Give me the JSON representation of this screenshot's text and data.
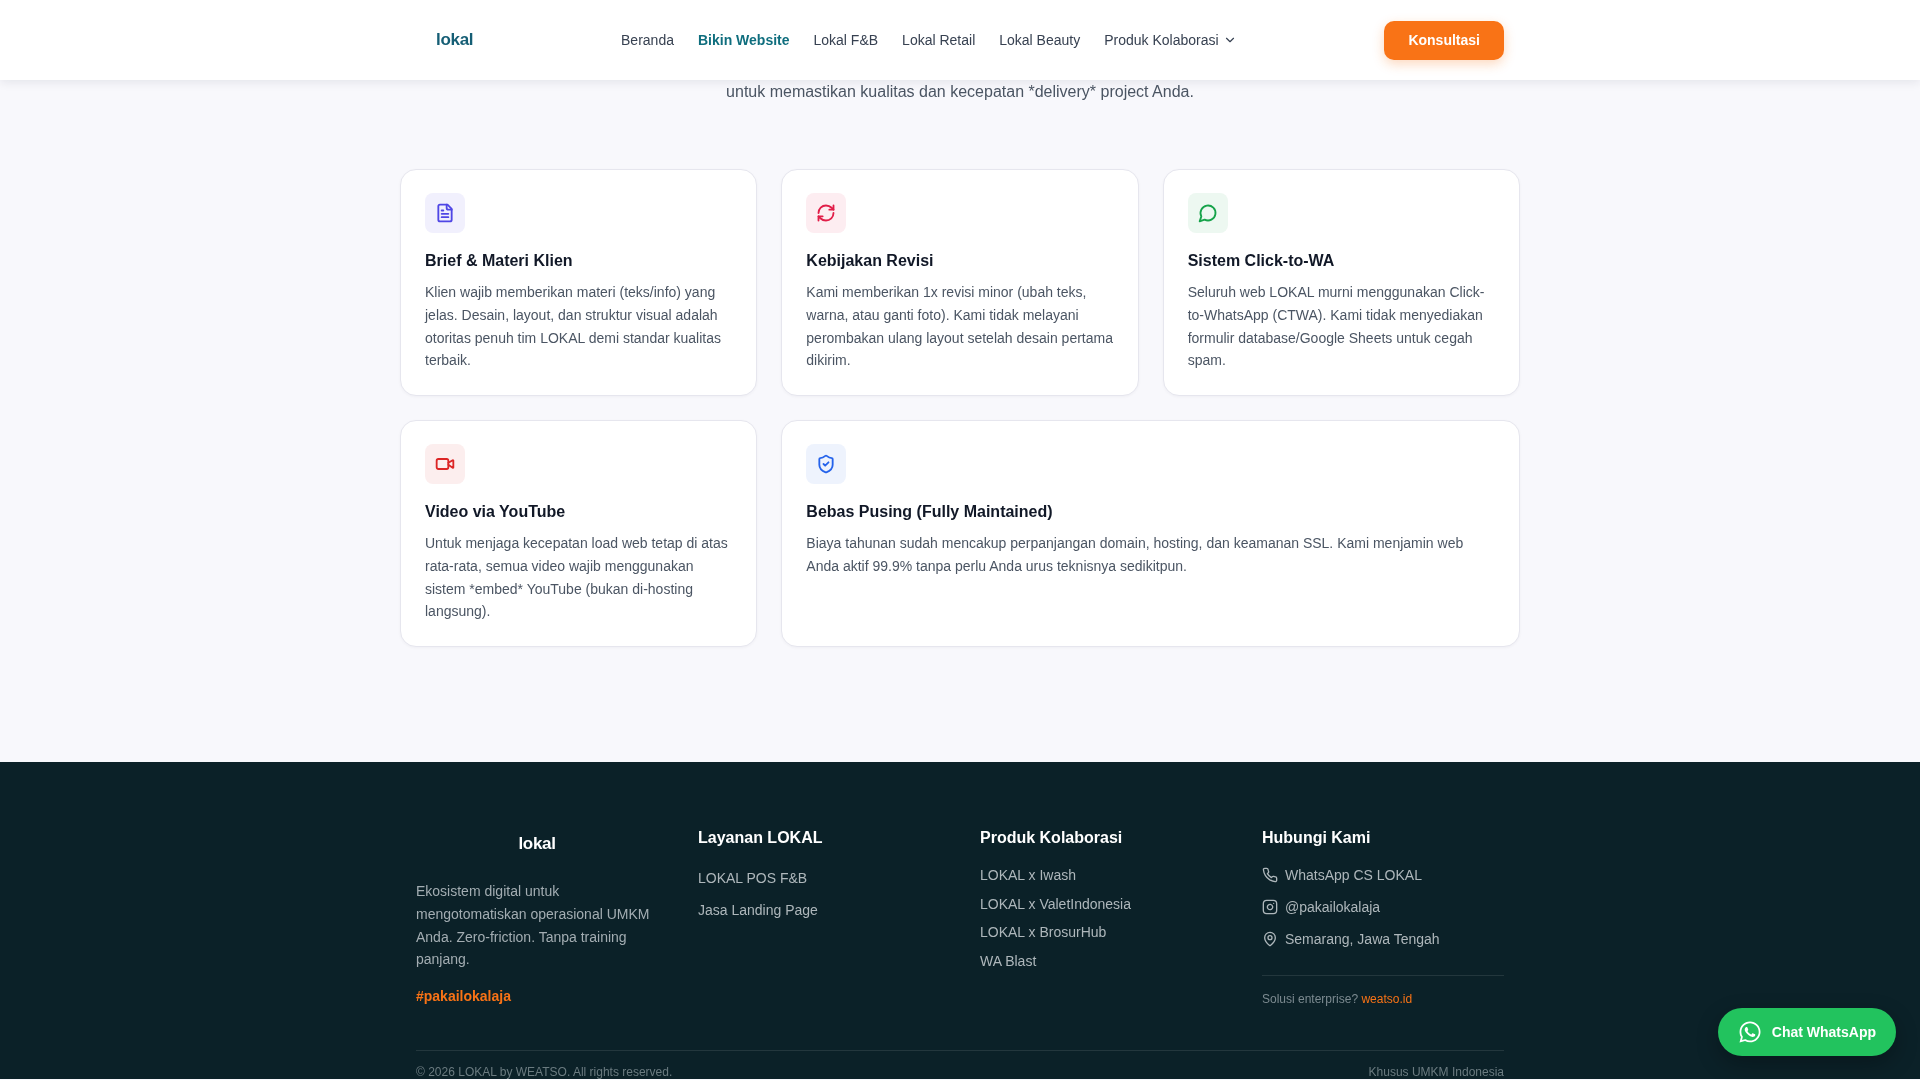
{
  "header": {
    "logo": "lokal",
    "nav": [
      {
        "label": "Beranda",
        "selected": false,
        "dropdown": false
      },
      {
        "label": "Bikin Website",
        "selected": true,
        "dropdown": false
      },
      {
        "label": "Lokal F&B",
        "selected": false,
        "dropdown": false
      },
      {
        "label": "Lokal Retail",
        "selected": false,
        "dropdown": false
      },
      {
        "label": "Lokal Beauty",
        "selected": false,
        "dropdown": false
      },
      {
        "label": "Produk Kolaborasi",
        "selected": false,
        "dropdown": true
      }
    ],
    "cta": "Konsultasi"
  },
  "intro": "untuk memastikan kualitas dan kecepatan *delivery* project Anda.",
  "cards": [
    {
      "title": "Brief & Materi Klien",
      "text": "Klien wajib memberikan materi (teks/info) yang jelas. Desain, layout, dan struktur visual adalah otoritas penuh tim LOKAL demi standar kualitas terbaik.",
      "color": "#4f46e5"
    },
    {
      "title": "Kebijakan Revisi",
      "text": "Kami memberikan 1x revisi minor (ubah teks, warna, atau ganti foto). Kami tidak melayani perombakan ulang layout setelah desain pertama dikirim.",
      "color": "#e11d48"
    },
    {
      "title": "Sistem Click-to-WA",
      "text": "Seluruh web LOKAL murni menggunakan Click-to-WhatsApp (CTWA). Kami tidak menyediakan formulir database/Google Sheets untuk cegah spam.",
      "color": "#16a34a"
    },
    {
      "title": "Video via YouTube",
      "text": "Untuk menjaga kecepatan load web tetap di atas rata-rata, semua video wajib menggunakan sistem *embed* YouTube (bukan di-hosting langsung).",
      "color": "#dc2626"
    },
    {
      "title": "Bebas Pusing (Fully Maintained)",
      "text": "Biaya tahunan sudah mencakup perpanjangan domain, hosting, dan keamanan SSL. Kami menjamin web Anda aktif 99.9% tanpa perlu Anda urus teknisnya sedikitpun.",
      "color": "#2563eb"
    }
  ],
  "footer": {
    "logo": "lokal",
    "about": "Ekosistem digital untuk mengotomatiskan operasional UMKM Anda. Zero-friction. Tanpa training panjang.",
    "hashtag": "#pakailokalaja",
    "link_columns": [
      {
        "title": "Layanan LOKAL",
        "links": [
          "LOKAL POS F&B",
          "Jasa Landing Page"
        ]
      },
      {
        "title": "Produk Kolaborasi",
        "links": [
          "LOKAL x Iwash",
          "LOKAL x ValetIndonesia",
          "LOKAL x BrosurHub",
          "WA Blast"
        ]
      }
    ],
    "contact": {
      "title": "Hubungi Kami",
      "items": [
        "WhatsApp CS LOKAL",
        "@pakailokalaja",
        "Semarang, Jawa Tengah"
      ],
      "note": "Solusi enterprise?",
      "note_link": "weatso.id"
    },
    "copyright": "© 2026 LOKAL by WEATSO. All rights reserved.",
    "tagline": "Khusus UMKM Indonesia"
  },
  "chat_button": "Chat WhatsApp"
}
